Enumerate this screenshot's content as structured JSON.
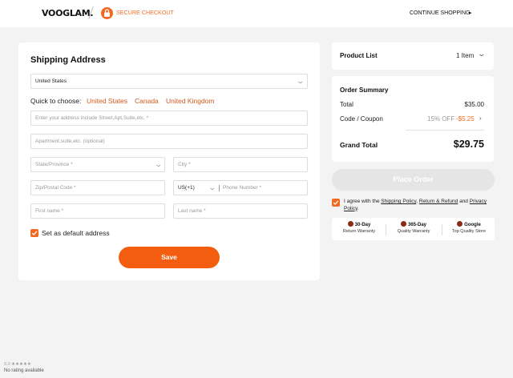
{
  "header": {
    "logo": "VOOGLAM.",
    "secure_checkout": "SECURE CHECKOUT",
    "continue_shopping": "CONTINUE SHOPPING",
    "continue_arrow": "▸"
  },
  "shipping": {
    "title": "Shipping Address",
    "country_value": "United States",
    "quick_label": "Quick to choose:",
    "quick_options": [
      "United States",
      "Canada",
      "United Kingdom"
    ],
    "address_placeholder": "Enter your address include Street,Apt,Suite,etc. *",
    "apartment_placeholder": "Apartment,suite,etc. (optional)",
    "state_placeholder": "State/Province *",
    "city_placeholder": "City *",
    "zip_placeholder": "Zip/Postal Code *",
    "phone_code": "US(+1)",
    "phone_placeholder": "Phone Number *",
    "first_name_placeholder": "First name *",
    "last_name_placeholder": "Last name *",
    "default_label": "Set as default address",
    "default_checked": true,
    "save_label": "Save"
  },
  "product_list": {
    "title": "Product List",
    "count": "1 Item"
  },
  "summary": {
    "title": "Order Summary",
    "total_label": "Total",
    "total_value": "$35.00",
    "coupon_label": "Code / Coupon",
    "coupon_off": "15% OFF",
    "coupon_discount": "-$5.25",
    "grand_label": "Grand Total",
    "grand_value": "$29.75"
  },
  "place_order_label": "Place Order",
  "agreement": {
    "prefix": "I agree with the ",
    "shipping_policy": "Shipping Policy",
    "sep1": ", ",
    "return_refund": "Return & Refund",
    "and": " and ",
    "privacy_policy": "Privacy Policy",
    "suffix": "."
  },
  "badges": [
    {
      "title": "30-Day",
      "sub": "Return Warranty"
    },
    {
      "title": "365-Day",
      "sub": "Quality Warranty"
    },
    {
      "title": "Google",
      "sub": "Top Quality Store"
    }
  ],
  "rating": {
    "score": "0.0 ★★★★★",
    "text": "No rating available"
  },
  "colors": {
    "accent": "#f26a21",
    "save_button": "#f35d0f",
    "place_order_disabled": "#e5e5e5",
    "background": "#f3f3f3"
  }
}
